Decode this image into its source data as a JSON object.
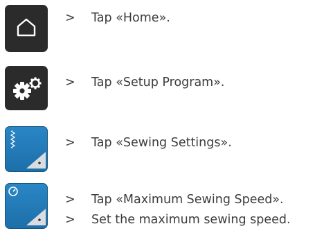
{
  "steps": [
    {
      "marker": ">",
      "text": "Tap «Home»."
    },
    {
      "marker": ">",
      "text": "Tap «Setup Program»."
    },
    {
      "marker": ">",
      "text": "Tap «Sewing Settings»."
    },
    {
      "marker": ">",
      "text": "Tap «Maximum Sewing Speed»."
    },
    {
      "marker": ">",
      "text": "Set the maximum sewing speed."
    }
  ],
  "icons": {
    "home": "home-icon",
    "setup": "gears-icon",
    "sewing_settings": "stitch-settings-icon",
    "max_speed": "speed-gauge-icon"
  },
  "colors": {
    "dark_button": "#2b2b2b",
    "blue_button": "#2379b8",
    "text": "#3c3c3c"
  }
}
